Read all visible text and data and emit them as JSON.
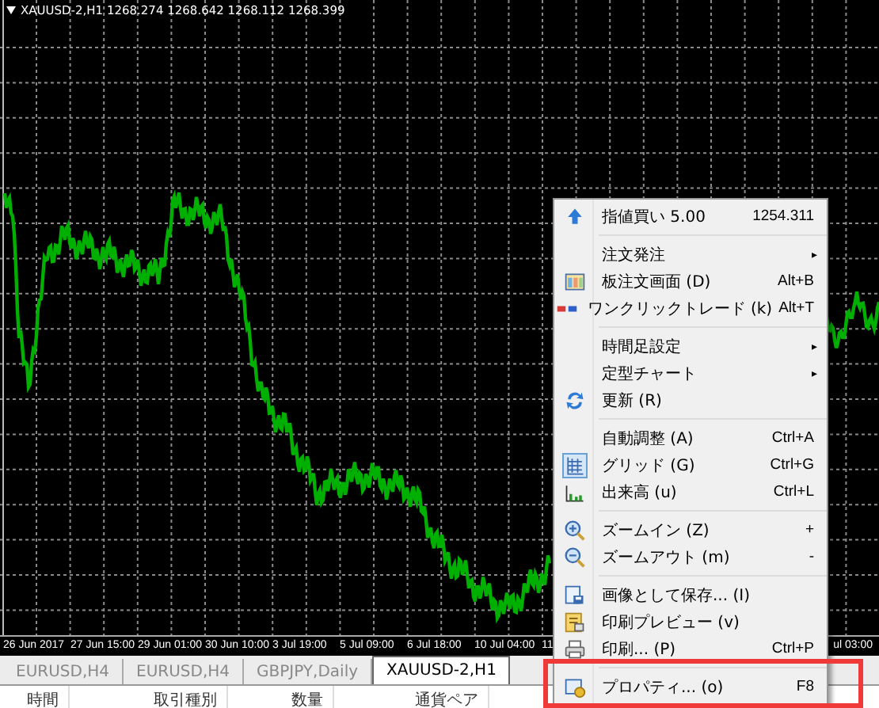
{
  "chart": {
    "title": "XAUUSD-2,H1  1268.274 1268.642 1268.112 1268.399",
    "time_labels": [
      "26 Jun 2017",
      "27 Jun 15:00",
      "29 Jun 01:00",
      "30 Jun 10:00",
      "3 Jul 19:00",
      "5 Jul 09:00",
      "6 Jul 18:00",
      "10 Jul 04:00",
      "11",
      "ul 03:00"
    ]
  },
  "context_menu": {
    "items": [
      {
        "kind": "item",
        "label": "指値買い 5.00",
        "shortcut": "1254.311"
      },
      {
        "kind": "separator"
      },
      {
        "kind": "item",
        "label": "注文発注",
        "submenu": "▸"
      },
      {
        "kind": "item",
        "label": "板注文画面 (D)",
        "shortcut": "Alt+B"
      },
      {
        "kind": "item",
        "label": "ワンクリックトレード (k)",
        "shortcut": "Alt+T"
      },
      {
        "kind": "separator"
      },
      {
        "kind": "item",
        "label": "時間足設定",
        "submenu": "▸"
      },
      {
        "kind": "item",
        "label": "定型チャート",
        "submenu": "▸"
      },
      {
        "kind": "item",
        "label": "更新 (R)"
      },
      {
        "kind": "separator"
      },
      {
        "kind": "item",
        "label": "自動調整 (A)",
        "shortcut": "Ctrl+A",
        "checked": false
      },
      {
        "kind": "item",
        "label": "グリッド (G)",
        "shortcut": "Ctrl+G",
        "checked": true
      },
      {
        "kind": "item",
        "label": "出来高 (u)",
        "shortcut": "Ctrl+L",
        "checked": false
      },
      {
        "kind": "separator"
      },
      {
        "kind": "item",
        "label": "ズームイン (Z)",
        "shortcut": "+"
      },
      {
        "kind": "item",
        "label": "ズームアウト (m)",
        "shortcut": "-"
      },
      {
        "kind": "separator"
      },
      {
        "kind": "item",
        "label": "画像として保存... (I)"
      },
      {
        "kind": "item",
        "label": "印刷プレビュー (v)"
      },
      {
        "kind": "item",
        "label": "印刷... (P)",
        "shortcut": "Ctrl+P"
      },
      {
        "kind": "separator"
      },
      {
        "kind": "item",
        "label": "プロパティ... (o)",
        "shortcut": "F8",
        "highlighted": true
      }
    ]
  },
  "tabs": [
    {
      "label": "EURUSD,H4",
      "selected": false
    },
    {
      "label": "EURUSD,H4",
      "selected": false
    },
    {
      "label": "GBPJPY,Daily",
      "selected": false
    },
    {
      "label": "XAUUSD-2,H1",
      "selected": true
    }
  ],
  "table": {
    "columns": [
      "時間",
      "取引種別",
      "数量",
      "通貨ペア"
    ]
  }
}
